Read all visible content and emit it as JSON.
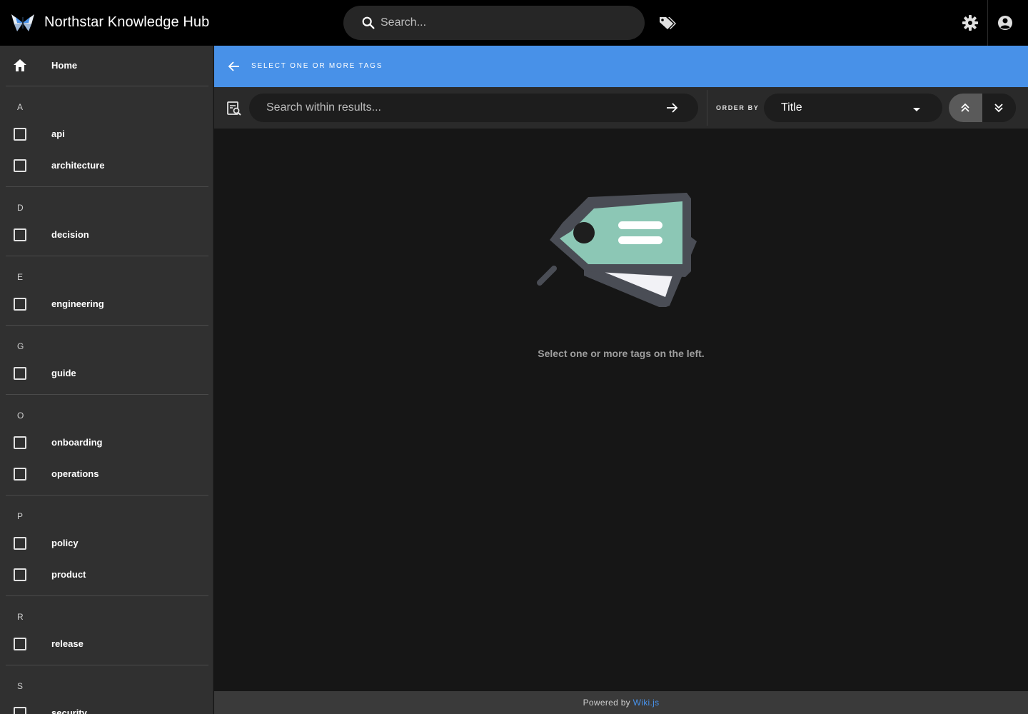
{
  "app": {
    "title": "Northstar Knowledge Hub",
    "accent_color": "#4891e8"
  },
  "header": {
    "search_placeholder": "Search...",
    "icons": [
      "search-icon",
      "tags-icon",
      "settings-icon",
      "account-icon"
    ]
  },
  "sidebar": {
    "home_label": "Home",
    "groups": [
      {
        "letter": "A",
        "tags": [
          "api",
          "architecture"
        ]
      },
      {
        "letter": "D",
        "tags": [
          "decision"
        ]
      },
      {
        "letter": "E",
        "tags": [
          "engineering"
        ]
      },
      {
        "letter": "G",
        "tags": [
          "guide"
        ]
      },
      {
        "letter": "O",
        "tags": [
          "onboarding",
          "operations"
        ]
      },
      {
        "letter": "P",
        "tags": [
          "policy",
          "product"
        ]
      },
      {
        "letter": "R",
        "tags": [
          "release"
        ]
      },
      {
        "letter": "S",
        "tags": [
          "security"
        ]
      }
    ]
  },
  "selection_bar": {
    "label": "SELECT ONE OR MORE TAGS"
  },
  "filter_bar": {
    "search_placeholder": "Search within results...",
    "order_by_label": "ORDER BY",
    "order_by_value": "Title"
  },
  "main": {
    "empty_message": "Select one or more tags on the left."
  },
  "footer": {
    "prefix": "Powered by",
    "link_text": "Wiki.js"
  }
}
